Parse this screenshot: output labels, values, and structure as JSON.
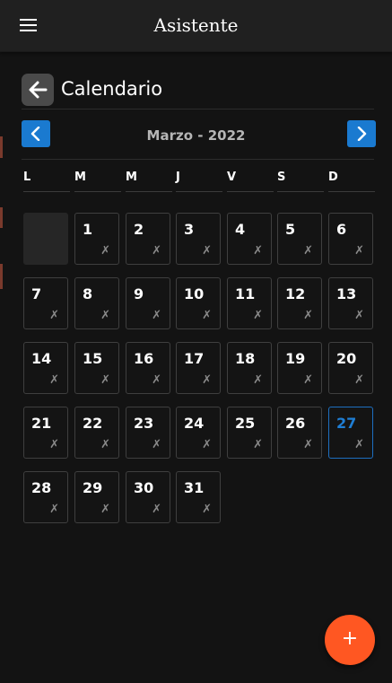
{
  "app": {
    "title": "Asistente"
  },
  "page": {
    "title": "Calendario"
  },
  "calendar": {
    "month_label": "Marzo - 2022",
    "weekdays": [
      "L",
      "M",
      "M",
      "J",
      "V",
      "S",
      "D"
    ],
    "leading_blank_days": 1,
    "days": [
      "1",
      "2",
      "3",
      "4",
      "5",
      "6",
      "7",
      "8",
      "9",
      "10",
      "11",
      "12",
      "13",
      "14",
      "15",
      "16",
      "17",
      "18",
      "19",
      "20",
      "21",
      "22",
      "23",
      "24",
      "25",
      "26",
      "27",
      "28",
      "29",
      "30",
      "31"
    ],
    "today": "27",
    "day_mark": "✗"
  },
  "fab": {
    "label": "+"
  },
  "colors": {
    "accent": "#1a7ad0",
    "fab": "#ff5722",
    "today_text": "#1f7ed4"
  },
  "icons": {
    "menu": "hamburger-menu-icon",
    "back": "arrow-left-icon",
    "prev": "chevron-left-icon",
    "next": "chevron-right-icon"
  }
}
